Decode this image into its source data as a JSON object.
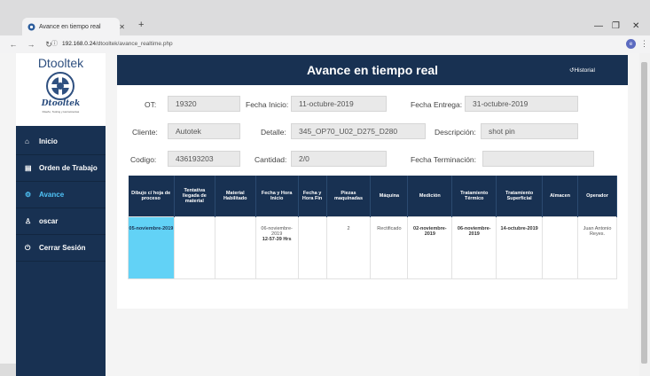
{
  "browser": {
    "tab_title": "Avance en tiempo real",
    "url_host": "192.168.0.24",
    "url_path": "/dtooltek/avance_realtime.php",
    "account_initial": "e"
  },
  "sidebar": {
    "brand": "Dtooltek",
    "logo_text": "Dtooltek",
    "logo_sub": "Diseño, Tooling y Herramientas",
    "items": [
      {
        "label": "Inicio",
        "icon": "home-icon"
      },
      {
        "label": "Orden de Trabajo",
        "icon": "document-icon"
      },
      {
        "label": "Avance",
        "icon": "gears-icon"
      },
      {
        "label": "oscar",
        "icon": "user-icon"
      },
      {
        "label": "Cerrar Sesión",
        "icon": "logout-icon"
      }
    ]
  },
  "header": {
    "title": "Avance en tiempo real",
    "historial": "Historial"
  },
  "form": {
    "ot_label": "OT:",
    "ot_value": "19320",
    "fecha_inicio_label": "Fecha Inicio:",
    "fecha_inicio_value": "11-octubre-2019",
    "fecha_entrega_label": "Fecha Entrega:",
    "fecha_entrega_value": "31-octubre-2019",
    "cliente_label": "Cliente:",
    "cliente_value": "Autotek",
    "detalle_label": "Detalle:",
    "detalle_value": "345_OP70_U02_D275_D280",
    "descripcion_label": "Descripción:",
    "descripcion_value": "shot pin",
    "codigo_label": "Codigo:",
    "codigo_value": "436193203",
    "cantidad_label": "Cantidad:",
    "cantidad_value": "2/0",
    "fecha_terminacion_label": "Fecha Terminación:",
    "fecha_terminacion_value": ""
  },
  "table": {
    "headers": [
      "Dibujo c/ hoja de proceso",
      "Tentativa llegada de material",
      "Material Habilitado",
      "Fecha y Hora Inicio",
      "Fecha y Hora Fin",
      "Piezas maquinadas",
      "Máquina",
      "Medición",
      "Tratamiento Térmico",
      "Tratamiento Superficial",
      "Almacen",
      "Operador"
    ],
    "row": {
      "dibujo": "05-noviembre-2019",
      "tentativa": "",
      "material": "",
      "inicio_date": "06-noviembre-2019",
      "inicio_time": "12-57-39 Hrs",
      "fin": "",
      "piezas": "2",
      "maquina": "Rectificado",
      "medicion": "02-noviembre-2019",
      "termico": "06-noviembre-2019",
      "superficial": "14-octubre-2019",
      "almacen": "",
      "operador": "Juan Antonio Reyes."
    }
  },
  "colors": {
    "navy": "#183152",
    "highlight": "#62d2f6",
    "active_link": "#4fc3f7"
  }
}
